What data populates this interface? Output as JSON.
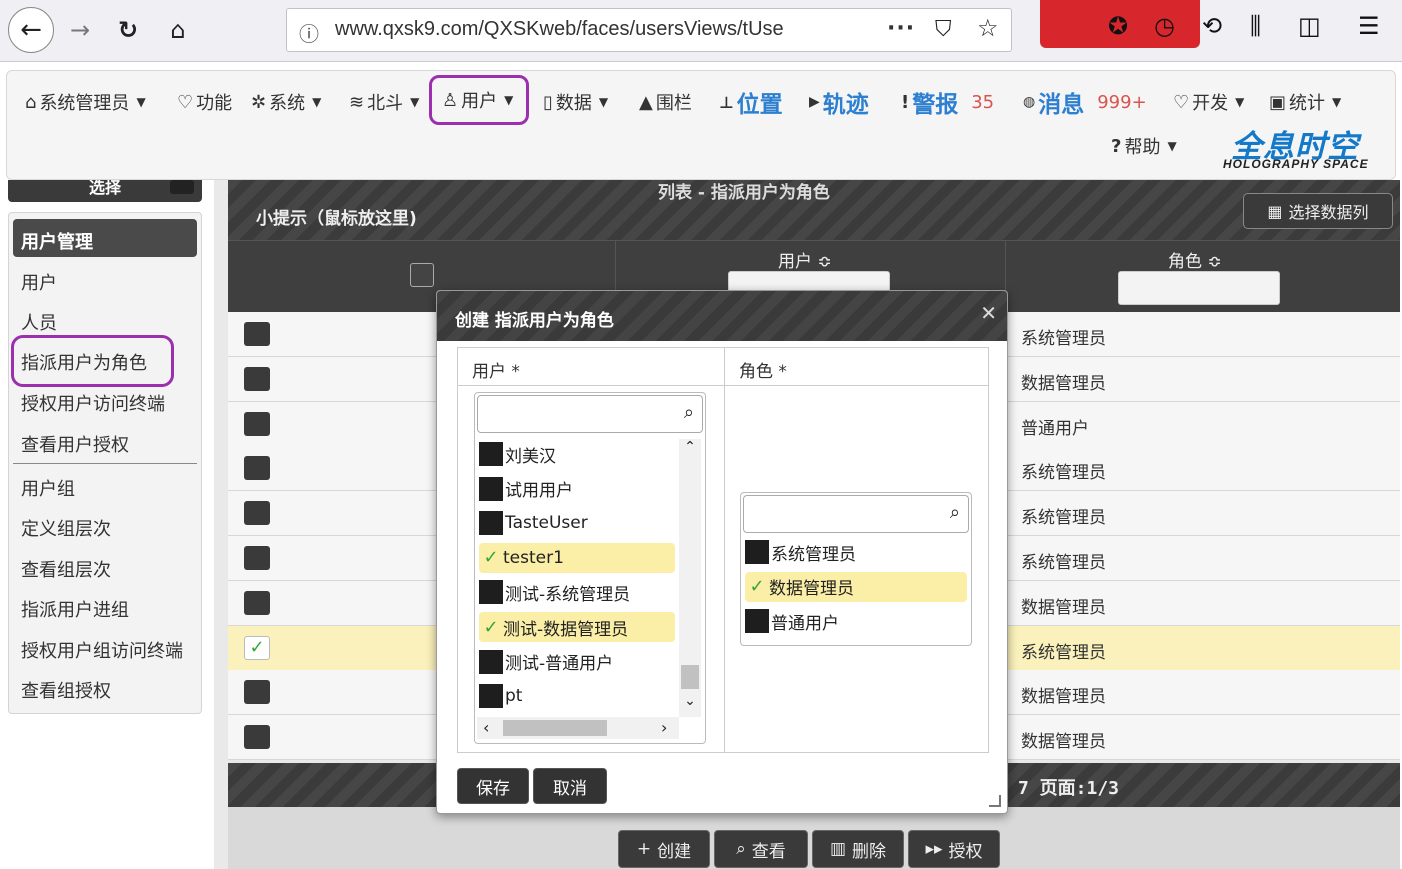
{
  "browser": {
    "url": "www.qxsk9.com/QXSKweb/faces/usersViews/tUse",
    "icons": [
      "back-icon",
      "forward-icon",
      "reload-icon",
      "home-icon",
      "info-icon",
      "more-icon",
      "pocket-icon",
      "bookmark-star-icon",
      "library-icon",
      "sidebar-icon",
      "hamburger-menu-icon"
    ]
  },
  "nav": {
    "admin": "系统管理员",
    "function": "功能",
    "system": "系统",
    "beidou": "北斗",
    "user": "用户",
    "data": "数据",
    "fence": "围栏",
    "position": "位置",
    "track": "轨迹",
    "alarm": "警报",
    "alarm_count": "35",
    "message": "消息",
    "message_count": "999+",
    "develop": "开发",
    "stats": "统计",
    "help": "帮助",
    "brand_logo": "全息时空",
    "brand_sub": "HOLOGRAPHY SPACE"
  },
  "sidebar": {
    "top_label": "选择",
    "section_title": "用户管理",
    "items": [
      "用户",
      "人员",
      "指派用户为角色",
      "授权用户访问终端",
      "查看用户授权",
      "用户组",
      "定义组层次",
      "查看组层次",
      "指派用户进组",
      "授权用户组访问终端",
      "查看组授权"
    ]
  },
  "list": {
    "title": "列表 - 指派用户为角色",
    "tip": "小提示（鼠标放这里)",
    "select_columns": "选择数据列",
    "col_user": "用户 ≎",
    "col_role": "角色 ≎",
    "rows": [
      {
        "role": "系统管理员",
        "selected": false
      },
      {
        "role": "数据管理员",
        "selected": false
      },
      {
        "role": "普通用户",
        "selected": false
      },
      {
        "role": "系统管理员",
        "selected": false
      },
      {
        "role": "系统管理员",
        "selected": false
      },
      {
        "role": "系统管理员",
        "selected": false
      },
      {
        "role": "数据管理员",
        "selected": false
      },
      {
        "role": "系统管理员",
        "selected": true
      },
      {
        "role": "数据管理员",
        "selected": false
      },
      {
        "role": "数据管理员",
        "selected": false
      }
    ],
    "page_info": "7 页面:1/3"
  },
  "actions": {
    "create": "创建",
    "view": "查看",
    "delete": "删除",
    "authorize": "授权"
  },
  "dialog": {
    "title": "创建 指派用户为角色",
    "user_label": "用户 *",
    "role_label": "角色 *",
    "users": [
      {
        "name": "刘美汉",
        "selected": false
      },
      {
        "name": "试用用户",
        "selected": false
      },
      {
        "name": "TasteUser",
        "selected": false
      },
      {
        "name": "tester1",
        "selected": true
      },
      {
        "name": "测试-系统管理员",
        "selected": false
      },
      {
        "name": "测试-数据管理员",
        "selected": true
      },
      {
        "name": "测试-普通用户",
        "selected": false
      },
      {
        "name": "pt",
        "selected": false
      }
    ],
    "roles": [
      {
        "name": "系统管理员",
        "selected": false
      },
      {
        "name": "数据管理员",
        "selected": true
      },
      {
        "name": "普通用户",
        "selected": false
      }
    ],
    "save": "保存",
    "cancel": "取消"
  }
}
